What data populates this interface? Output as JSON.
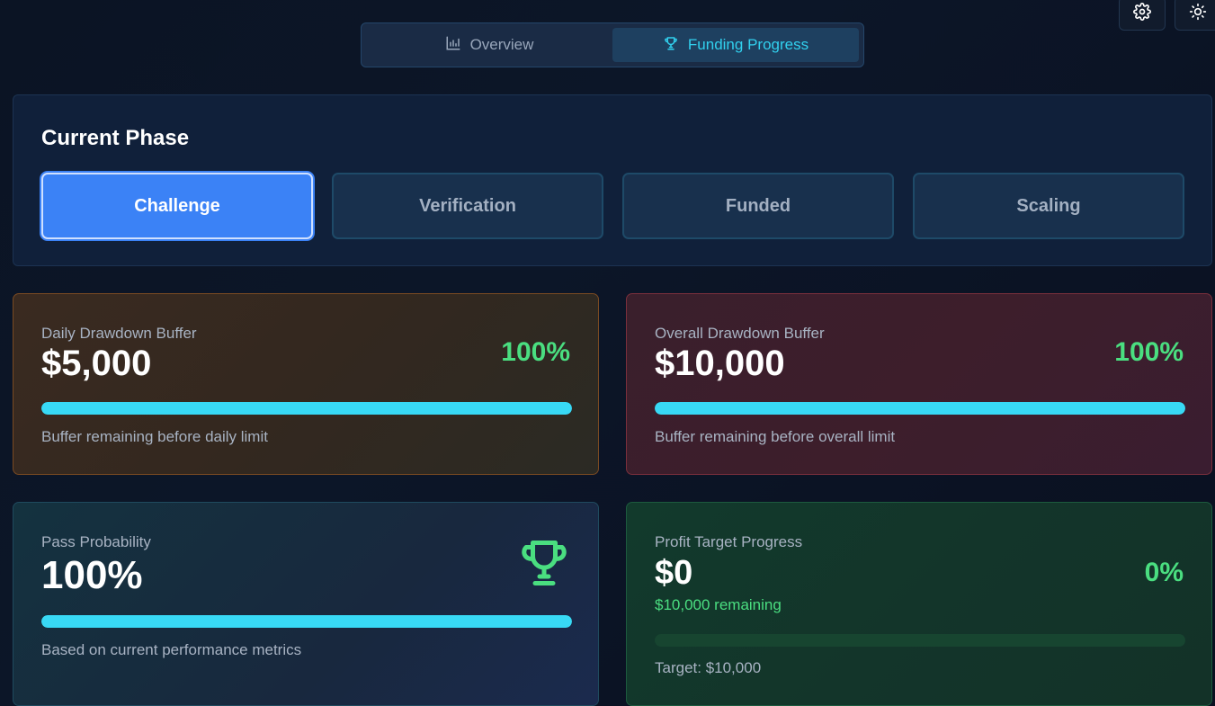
{
  "tabs": [
    {
      "label": "Overview",
      "icon": "bar-chart-icon",
      "active": false
    },
    {
      "label": "Funding Progress",
      "icon": "trophy-icon",
      "active": true
    }
  ],
  "toolbar": {
    "settings_icon": "gear-icon",
    "theme_icon": "sun-icon"
  },
  "phase": {
    "title": "Current Phase",
    "options": [
      "Challenge",
      "Verification",
      "Funded",
      "Scaling"
    ],
    "selected": "Challenge"
  },
  "daily": {
    "label": "Daily Drawdown Buffer",
    "value": "$5,000",
    "percent": "100%",
    "progress": 1.0,
    "note": "Buffer remaining before daily limit"
  },
  "overall": {
    "label": "Overall Drawdown Buffer",
    "value": "$10,000",
    "percent": "100%",
    "progress": 1.0,
    "note": "Buffer remaining before overall limit"
  },
  "pass": {
    "label": "Pass Probability",
    "value": "100%",
    "progress": 1.0,
    "note": "Based on current performance metrics",
    "icon": "trophy-icon"
  },
  "profit": {
    "label": "Profit Target Progress",
    "value": "$0",
    "percent": "0%",
    "remaining": "$10,000 remaining",
    "progress": 0.0,
    "note": "Target: $10,000"
  },
  "colors": {
    "accent": "#31d0ee",
    "active_phase": "#3b82f6",
    "positive": "#4ade80",
    "bar": "#38d9f5"
  }
}
